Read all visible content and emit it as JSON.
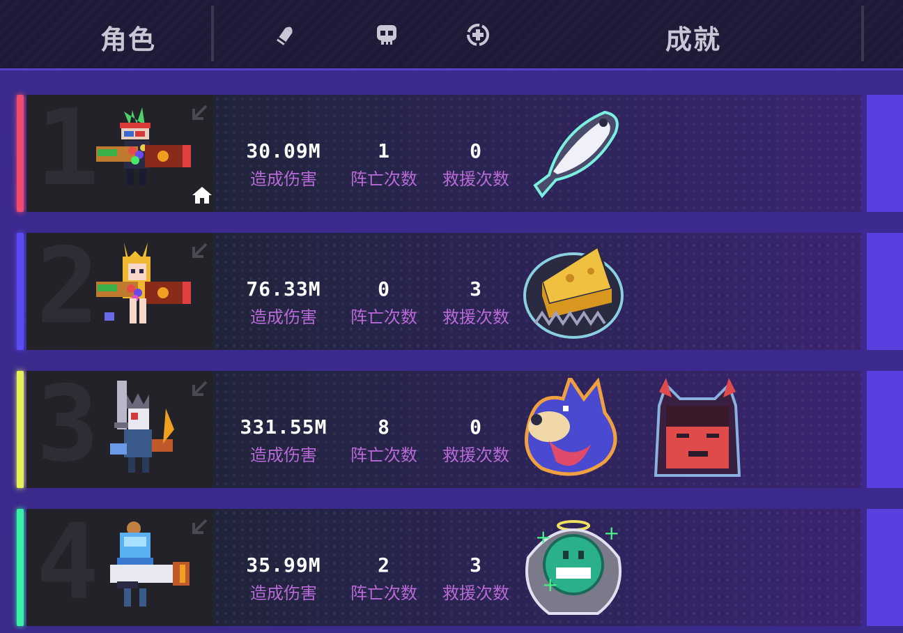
{
  "header": {
    "character_label": "角色",
    "achievement_label": "成就",
    "icons": [
      "bullet-icon",
      "skull-icon",
      "revive-icon"
    ]
  },
  "rows": [
    {
      "rank": "1",
      "accent_color": "#f04a6e",
      "damage": "30.09M",
      "damage_label": "造成伤害",
      "deaths": "1",
      "deaths_label": "阵亡次数",
      "rescues": "0",
      "rescues_label": "救援次数",
      "host": true,
      "badges": [
        "fish-badge"
      ]
    },
    {
      "rank": "2",
      "accent_color": "#5a4cf0",
      "damage": "76.33M",
      "damage_label": "造成伤害",
      "deaths": "0",
      "deaths_label": "阵亡次数",
      "rescues": "3",
      "rescues_label": "救援次数",
      "host": false,
      "badges": [
        "cheese-trap-badge"
      ]
    },
    {
      "rank": "3",
      "accent_color": "#e6f05a",
      "damage": "331.55M",
      "damage_label": "造成伤害",
      "deaths": "8",
      "deaths_label": "阵亡次数",
      "rescues": "0",
      "rescues_label": "救援次数",
      "host": false,
      "badges": [
        "wolf-badge",
        "demon-girl-badge"
      ]
    },
    {
      "rank": "4",
      "accent_color": "#3af0a8",
      "damage": "35.99M",
      "damage_label": "造成伤害",
      "deaths": "2",
      "deaths_label": "阵亡次数",
      "rescues": "3",
      "rescues_label": "救援次数",
      "host": false,
      "badges": [
        "angel-smiley-badge"
      ]
    }
  ]
}
